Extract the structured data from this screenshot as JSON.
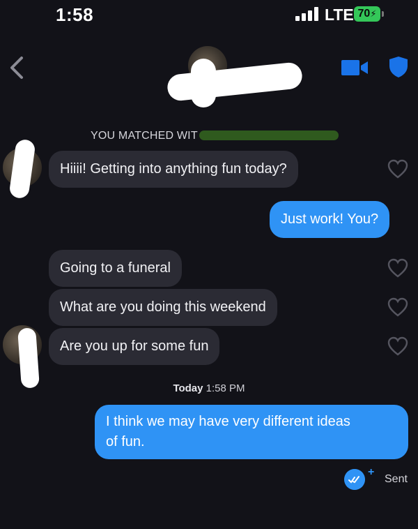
{
  "status_bar": {
    "time": "1:58",
    "network": "LTE",
    "battery": "70"
  },
  "header": {
    "back_icon": "chevron-left-icon",
    "video_icon": "video-camera-icon",
    "safety_icon": "shield-icon",
    "accent_color": "#1a73e8"
  },
  "matched_banner": "YOU MATCHED WIT",
  "messages": [
    {
      "direction": "in",
      "text": "Hiiii! Getting into anything fun today?"
    },
    {
      "direction": "out",
      "text": "Just work! You?"
    },
    {
      "direction": "in",
      "text": "Going to a funeral"
    },
    {
      "direction": "in",
      "text": "What are you doing this weekend"
    },
    {
      "direction": "in",
      "text": "Are you up for some fun"
    },
    {
      "direction": "out",
      "lines": [
        "I think we may have very different ideas",
        "of fun."
      ]
    }
  ],
  "timestamp": {
    "day": "Today",
    "time": "1:58 PM"
  },
  "receipt": {
    "status": "Sent",
    "plus": "+"
  },
  "colors": {
    "background": "#121218",
    "incoming_bubble": "#2b2b34",
    "outgoing_bubble": "#2f93f5",
    "battery": "#34c759"
  }
}
